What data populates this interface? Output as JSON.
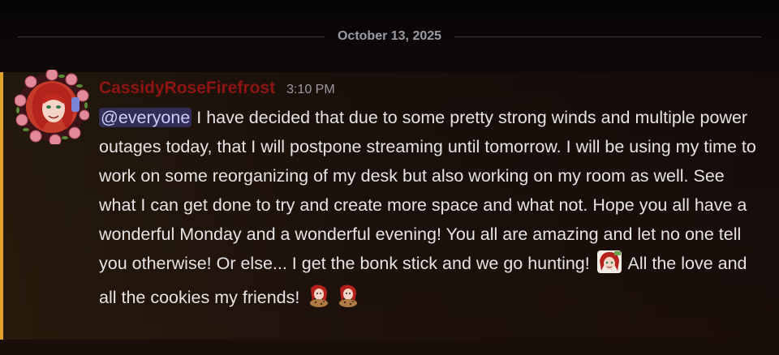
{
  "divider": {
    "date": "October 13, 2025"
  },
  "message": {
    "author": "CassidyRoseFirefrost",
    "timestamp": "3:10 PM",
    "mention": "@everyone",
    "text_parts": [
      " I have decided that due to some pretty strong winds and multiple power outages today, that I will postpone streaming until tomorrow. I will be using my time to work on some reorganizing of my desk but also working on my room as well. See what I can get done to try and create more space and what not. Hope you all have a wonderful Monday and a wonderful evening! You all are amazing and let no one tell you otherwise! Or else... I get the bonk stick and we go hunting! ",
      " All the love and all the cookies my friends! "
    ],
    "emojis": [
      "custom-face-emoji",
      "custom-cookie-emoji",
      "custom-cookie-emoji"
    ],
    "colors": {
      "author": "#8f1414",
      "accent_bar": "#e2a32d",
      "mention_bg": "#5865f2"
    }
  }
}
